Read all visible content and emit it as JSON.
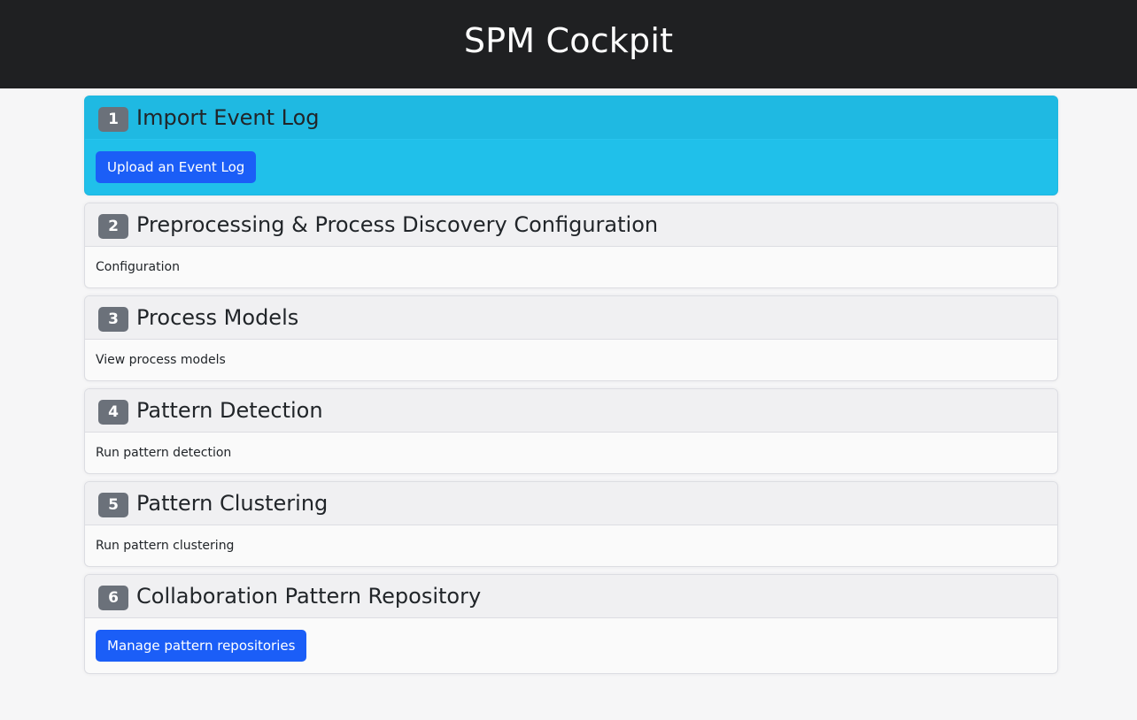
{
  "header": {
    "title": "SPM Cockpit"
  },
  "steps": [
    {
      "number": "1",
      "title": "Import Event Log",
      "action": "Upload an Event Log"
    },
    {
      "number": "2",
      "title": "Preprocessing & Process Discovery Configuration",
      "action": "Configuration"
    },
    {
      "number": "3",
      "title": "Process Models",
      "action": "View process models"
    },
    {
      "number": "4",
      "title": "Pattern Detection",
      "action": "Run pattern detection"
    },
    {
      "number": "5",
      "title": "Pattern Clustering",
      "action": "Run pattern clustering"
    },
    {
      "number": "6",
      "title": "Collaboration Pattern Repository",
      "action": "Manage pattern repositories"
    }
  ],
  "colors": {
    "header_bg": "#1f2022",
    "active_step_bg": "#20c0ea",
    "primary_button": "#1b5ef7",
    "badge_bg": "#6b717a"
  }
}
